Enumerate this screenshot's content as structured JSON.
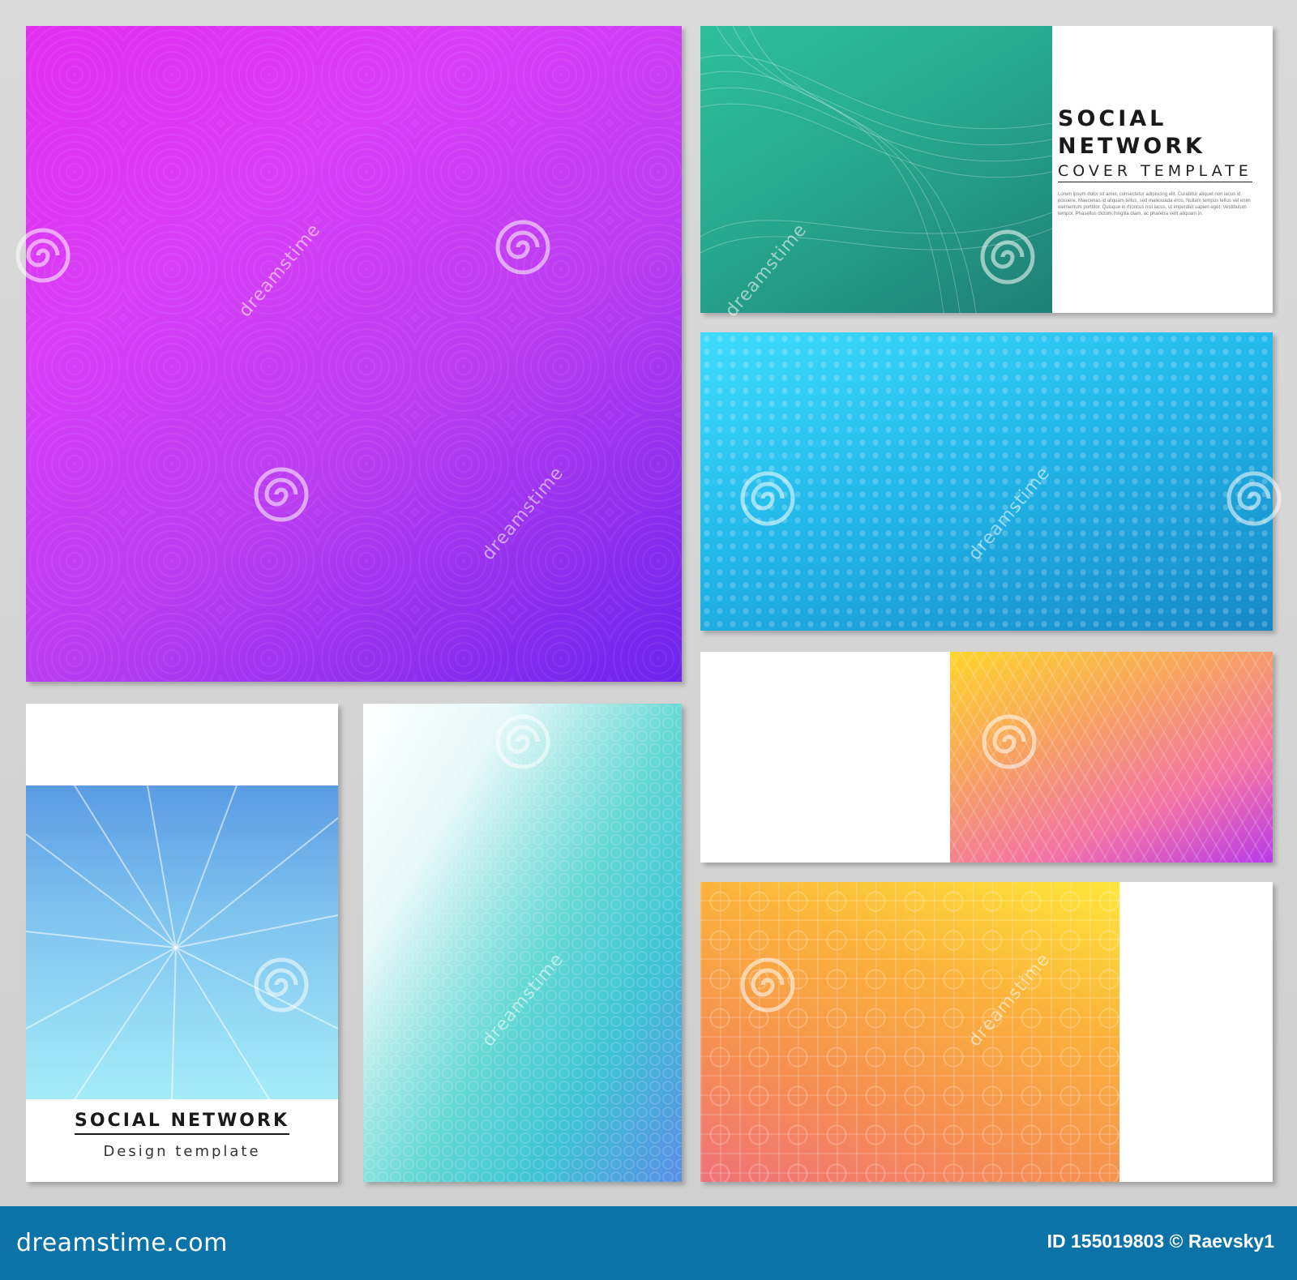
{
  "covers": {
    "green_cover": {
      "title_line1": "SOCIAL",
      "title_line2": "NETWORK",
      "subtitle": "COVER TEMPLATE",
      "body_text": "Lorem ipsum dolor sit amet, consectetur adipiscing elit. Curabitur aliquet non lacus id posuere. Maecenas id aliquam tellus, sed malesuada eros. Nullam tempus tellus vel enim elementum porttitor. Quisque in rhoncus nisi lacus, ut imperdiet sapien eget. Vestibulum tempor. Phasellus dictum fringilla diam, ac pharetra velit aliquam in."
    },
    "flyer": {
      "title": "SOCIAL NETWORK",
      "subtitle": "Design template"
    }
  },
  "watermark": {
    "text": "dreamstime"
  },
  "footer": {
    "logo_text": "dreamstime.com",
    "image_id": "ID 155019803 © Raevsky1"
  },
  "colors": {
    "footer_bg": "#0c73a9",
    "magenta": "#e32ff0",
    "violet": "#6b24ec",
    "green": "#27a98f",
    "cyan": "#22b8ea",
    "yellow": "#ffe73a",
    "orange": "#f58e52"
  }
}
